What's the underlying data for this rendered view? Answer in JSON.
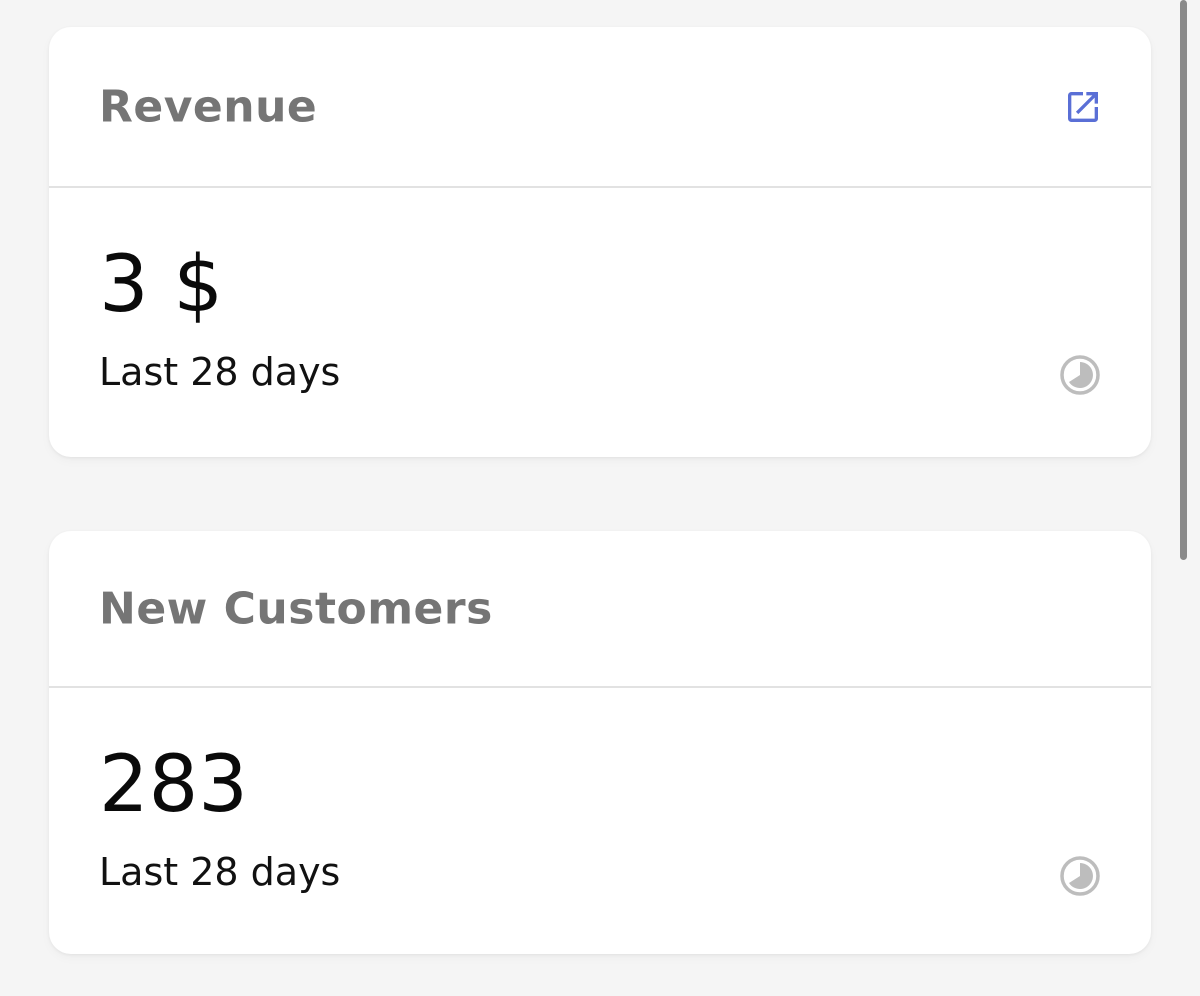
{
  "colors": {
    "background": "#f5f5f5",
    "card": "#ffffff",
    "title": "#757575",
    "accent": "#5a6fd6",
    "status_icon": "#bdbdbd"
  },
  "cards": [
    {
      "title": "Revenue",
      "value": "3 $",
      "period": "Last 28 days",
      "header_icon": "external-link-icon",
      "status_icon": "clock-pie-icon"
    },
    {
      "title": "New Customers",
      "value": "283",
      "period": "Last 28 days",
      "status_icon": "clock-pie-icon"
    }
  ]
}
